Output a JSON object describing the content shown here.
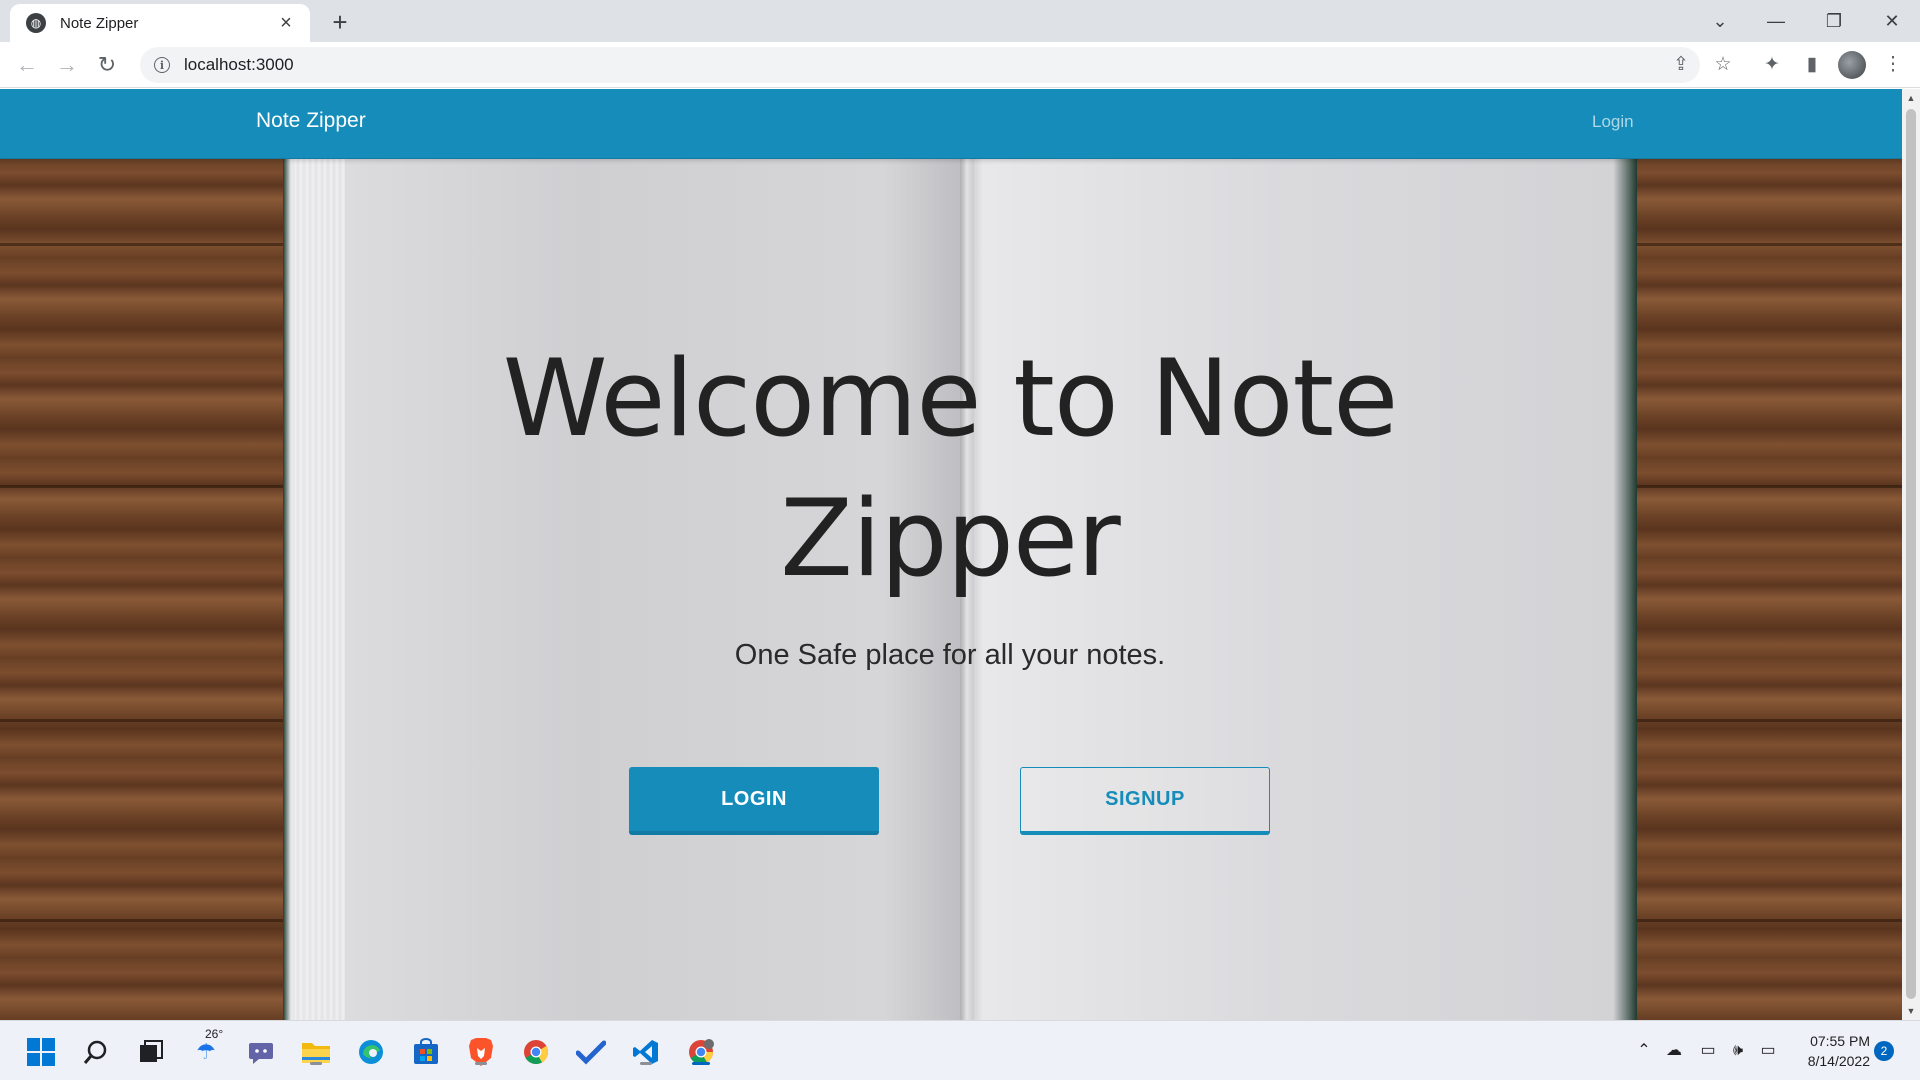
{
  "browser": {
    "tab_title": "Note Zipper",
    "url": "localhost:3000",
    "new_tab_symbol": "+",
    "icons": [
      "globe-icon",
      "close-icon",
      "back-icon",
      "forward-icon",
      "reload-icon",
      "info-icon",
      "share-icon",
      "star-icon",
      "extensions-icon",
      "side-panel-icon",
      "profile-avatar",
      "menu-icon",
      "tab-search-icon",
      "minimize-icon",
      "restore-icon",
      "window-close-icon"
    ]
  },
  "app": {
    "brand": "Note Zipper",
    "nav_login": "Login",
    "hero_title": "Welcome to Note Zipper",
    "hero_subtitle": "One Safe place for all your notes.",
    "login_button": "LOGIN",
    "signup_button": "SIGNUP",
    "colors": {
      "primary": "#158cba",
      "text": "#222222"
    }
  },
  "taskbar": {
    "weather_temp": "26°",
    "time": "07:55 PM",
    "date": "8/14/2022",
    "notification_count": "2",
    "apps": [
      "start-icon",
      "search-icon",
      "task-view-icon",
      "weather-icon",
      "teams-chat-icon",
      "file-explorer-icon",
      "edge-icon",
      "store-icon",
      "brave-icon",
      "chrome-icon",
      "todo-icon",
      "vscode-icon",
      "chrome-profile-icon"
    ]
  }
}
